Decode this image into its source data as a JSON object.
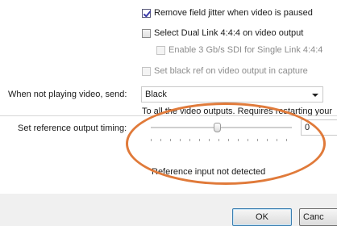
{
  "options": {
    "remove_jitter_label": "Remove field jitter when video is paused",
    "remove_jitter_checked": true,
    "dual_link_label": "Select Dual Link 4:4:4 on video output",
    "dual_link_checked": false,
    "enable_3g_label": "Enable 3 Gb/s SDI for Single Link 4:4:4",
    "enable_3g_checked": false,
    "black_ref_label": "Set black ref on video output in capture",
    "black_ref_checked": false
  },
  "not_playing": {
    "label": "When not playing video, send:",
    "selected": "Black",
    "note": "To all the video outputs. Requires restarting your"
  },
  "timing": {
    "label": "Set reference output timing:",
    "value": "0",
    "status": "Reference input not detected"
  },
  "buttons": {
    "ok": "OK",
    "cancel": "Canc"
  },
  "colors": {
    "highlight": "#e07a3a"
  }
}
